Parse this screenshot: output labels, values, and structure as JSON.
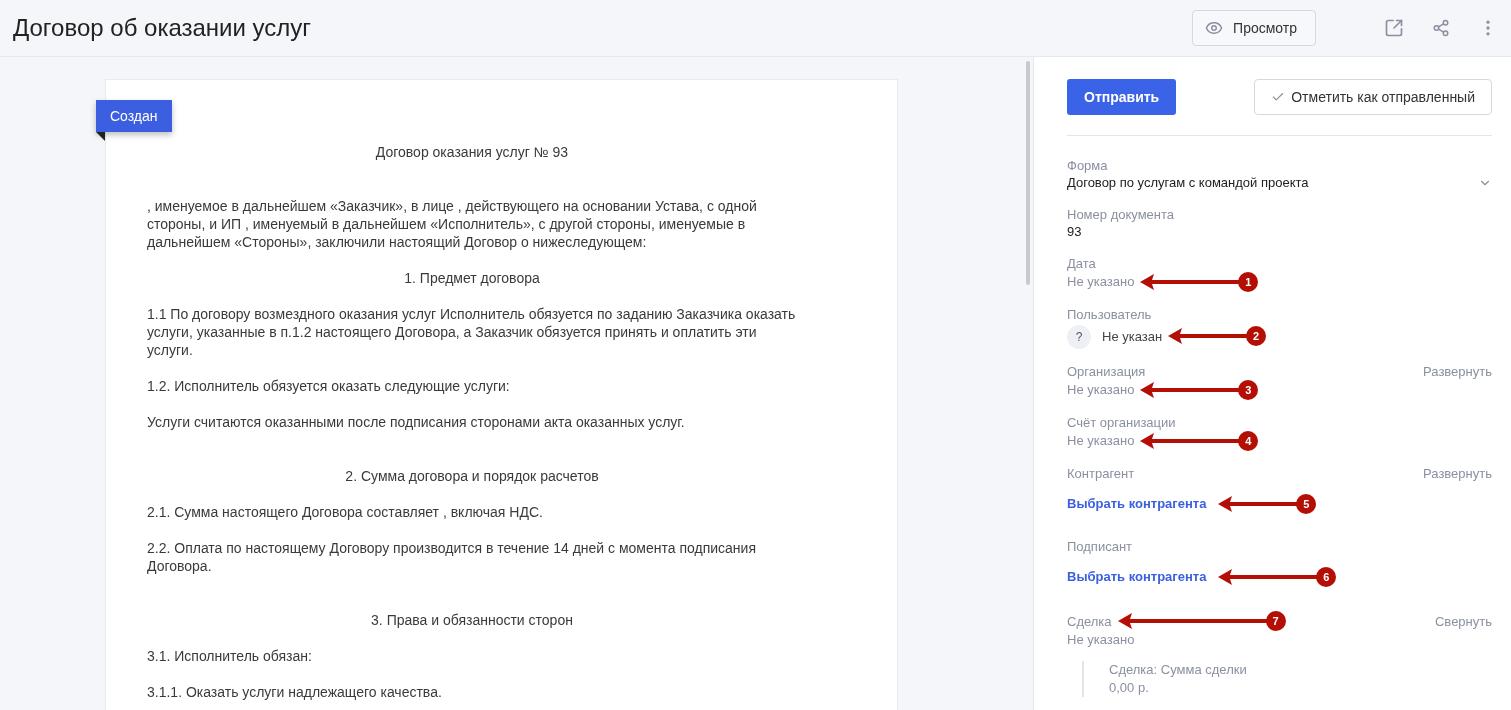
{
  "header": {
    "title": "Договор об оказании услуг",
    "preview_button": "Просмотр"
  },
  "document": {
    "status_ribbon": "Создан",
    "blocks": [
      {
        "kind": "heading",
        "text": "Договор оказания услуг № 93"
      },
      {
        "kind": "spacer"
      },
      {
        "kind": "paragraph",
        "text": ", именуемое в дальнейшем «Заказчик», в лице , действующего на основании Устава, с одной стороны, и ИП , именуемый в дальнейшем «Исполнитель», с другой стороны, именуемые в дальнейшем «Стороны», заключили настоящий Договор о нижеследующем:"
      },
      {
        "kind": "heading",
        "text": "1. Предмет договора"
      },
      {
        "kind": "paragraph",
        "text": "1.1 По договору возмездного оказания услуг Исполнитель обязуется по заданию Заказчика оказать услуги, указанные в п.1.2 настоящего Договора, а Заказчик обязуется принять и оплатить эти услуги."
      },
      {
        "kind": "paragraph",
        "text": "1.2. Исполнитель обязуется оказать следующие услуги:"
      },
      {
        "kind": "paragraph",
        "text": "Услуги считаются оказанными после подписания сторонами акта оказанных услуг."
      },
      {
        "kind": "spacer"
      },
      {
        "kind": "heading",
        "text": "2. Сумма договора и порядок расчетов"
      },
      {
        "kind": "paragraph",
        "text": "2.1. Сумма настоящего Договора составляет , включая НДС."
      },
      {
        "kind": "paragraph",
        "text": "2.2. Оплата по настоящему Договору производится в течение 14 дней с момента подписания Договора."
      },
      {
        "kind": "spacer"
      },
      {
        "kind": "heading",
        "text": "3. Права и обязанности сторон"
      },
      {
        "kind": "paragraph",
        "text": "3.1. Исполнитель обязан:"
      },
      {
        "kind": "paragraph",
        "text": "3.1.1. Оказать услуги надлежащего качества."
      }
    ]
  },
  "side_panel": {
    "send_button": "Отправить",
    "mark_sent_button": "Отметить как отправленный",
    "fields": [
      {
        "kind": "select",
        "label": "Форма",
        "value": "Договор по услугам с командой проекта"
      },
      {
        "kind": "text",
        "label": "Номер документа",
        "value": "93"
      },
      {
        "kind": "empty",
        "label": "Дата",
        "value": "Не указано",
        "value_marker": "1"
      },
      {
        "kind": "user",
        "label": "Пользователь",
        "avatar": "?",
        "value": "Не указан",
        "value_marker": "2"
      },
      {
        "kind": "empty",
        "label": "Организация",
        "action": "Развернуть",
        "value": "Не указано",
        "value_marker": "3"
      },
      {
        "kind": "empty",
        "label": "Счёт организации",
        "value": "Не указано",
        "value_marker": "4"
      },
      {
        "kind": "link",
        "label": "Контрагент",
        "action": "Развернуть",
        "value": "Выбрать контрагента",
        "value_marker": "5"
      },
      {
        "kind": "link",
        "label": "Подписант",
        "value": "Выбрать контрагента",
        "value_marker": "6"
      },
      {
        "kind": "empty",
        "label": "Сделка",
        "action": "Свернуть",
        "value": "Не указано",
        "label_marker": "7",
        "details": [
          {
            "label": "Сделка: Сумма сделки",
            "value": "0,00 р."
          }
        ]
      }
    ]
  }
}
